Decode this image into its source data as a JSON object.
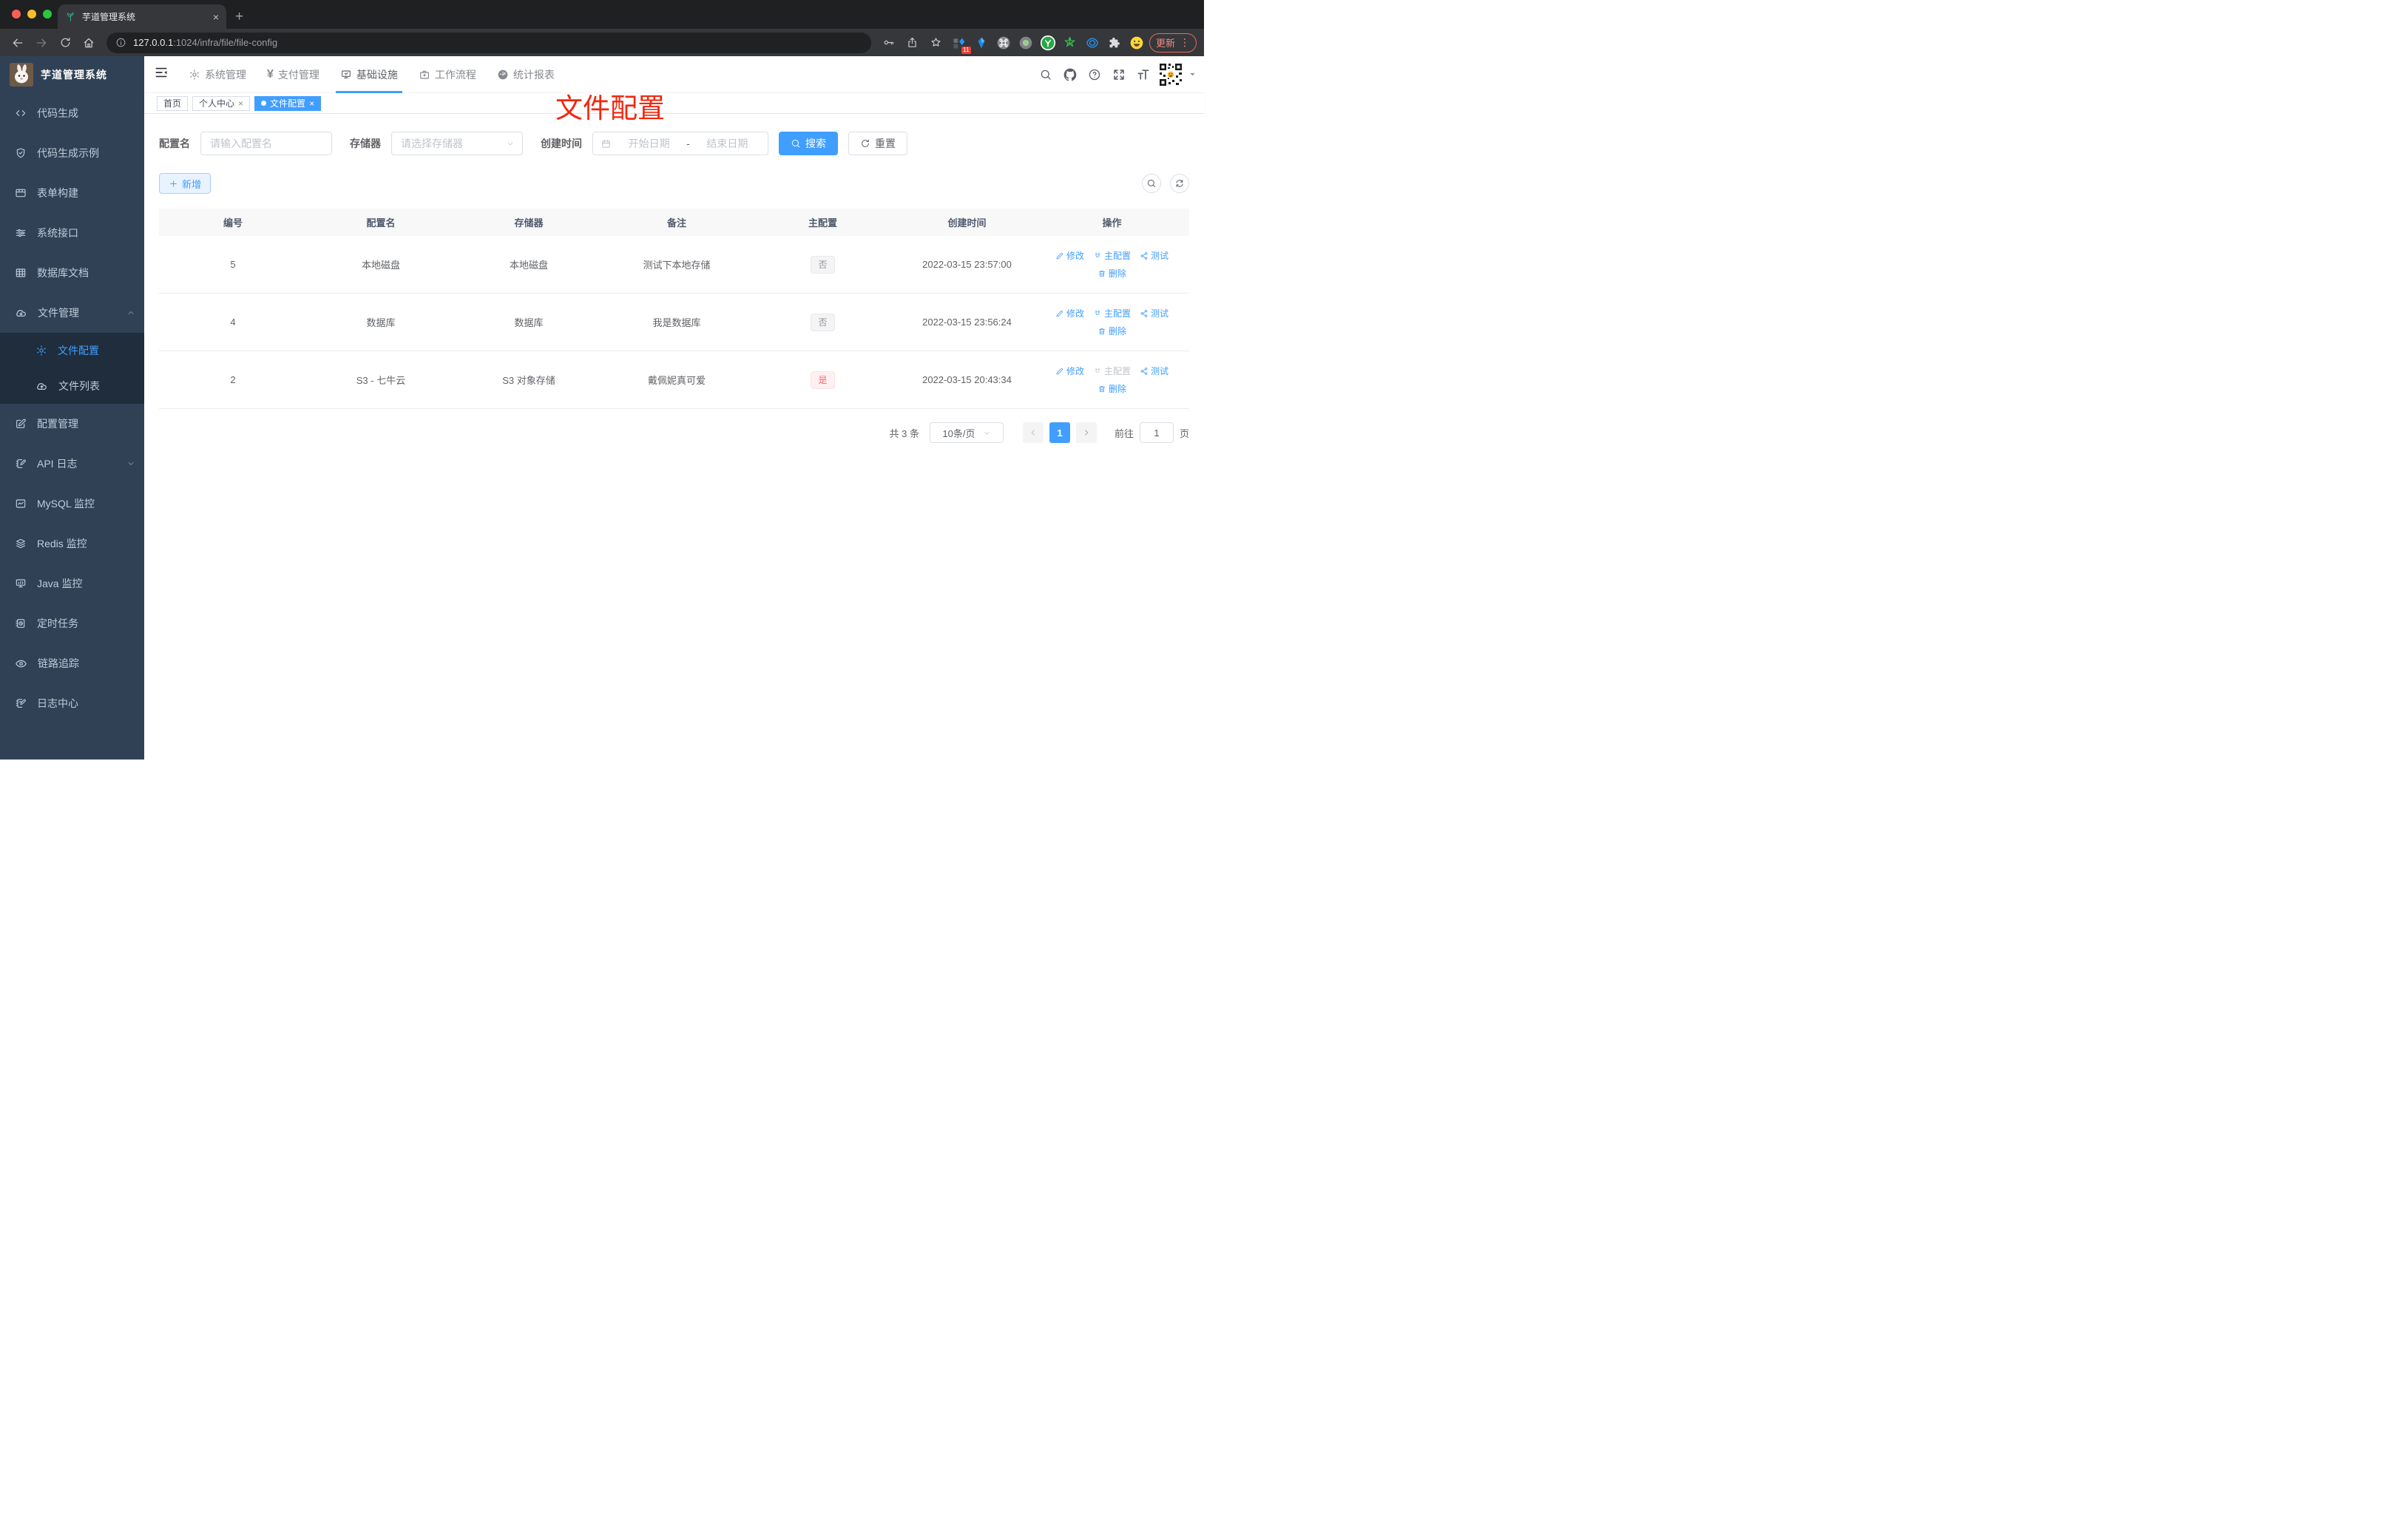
{
  "browser": {
    "tab_title": "芋道管理系统",
    "close_glyph": "×",
    "new_tab_glyph": "+",
    "url_host": "127.0.0.1",
    "url_rest": ":1024/infra/file/file-config",
    "ext_badge": "11",
    "update_label": "更新",
    "menu_dots": "⋮"
  },
  "sidebar": {
    "title": "芋道管理系统",
    "items": [
      {
        "label": "代码生成",
        "icon": "code-icon"
      },
      {
        "label": "代码生成示例",
        "icon": "shield-check-icon"
      },
      {
        "label": "表单构建",
        "icon": "form-icon"
      },
      {
        "label": "系统接口",
        "icon": "sliders-icon"
      },
      {
        "label": "数据库文档",
        "icon": "grid-icon"
      },
      {
        "label": "文件管理",
        "icon": "cloud-download-icon"
      },
      {
        "label": "文件配置",
        "icon": "gear-icon"
      },
      {
        "label": "文件列表",
        "icon": "cloud-upload-icon"
      },
      {
        "label": "配置管理",
        "icon": "edit-square-icon"
      },
      {
        "label": "API 日志",
        "icon": "doc-edit-icon"
      },
      {
        "label": "MySQL 监控",
        "icon": "chart-icon"
      },
      {
        "label": "Redis 监控",
        "icon": "layers-icon"
      },
      {
        "label": "Java 监控",
        "icon": "monitor-icon"
      },
      {
        "label": "定时任务",
        "icon": "schedule-icon"
      },
      {
        "label": "链路追踪",
        "icon": "eye-icon"
      },
      {
        "label": "日志中心",
        "icon": "log-icon"
      }
    ]
  },
  "topnav": {
    "items": [
      {
        "label": "系统管理",
        "icon": "gear-icon"
      },
      {
        "label": "支付管理",
        "icon": "yen-icon",
        "glyph": "¥"
      },
      {
        "label": "基础设施",
        "icon": "monitor-check-icon"
      },
      {
        "label": "工作流程",
        "icon": "briefcase-icon"
      },
      {
        "label": "统计报表",
        "icon": "gauge-icon"
      }
    ]
  },
  "tabs": {
    "close_glyph": "×",
    "items": [
      {
        "label": "首页"
      },
      {
        "label": "个人中心"
      },
      {
        "label": "文件配置"
      }
    ]
  },
  "annotation": {
    "text": "文件配置"
  },
  "filters": {
    "name_label": "配置名",
    "name_placeholder": "请输入配置名",
    "storage_label": "存储器",
    "storage_placeholder": "请选择存储器",
    "date_label": "创建时间",
    "date_start": "开始日期",
    "date_sep": "-",
    "date_end": "结束日期",
    "search_label": "搜索",
    "reset_label": "重置"
  },
  "toolbar": {
    "add_label": "新增"
  },
  "table": {
    "headers": [
      "编号",
      "配置名",
      "存储器",
      "备注",
      "主配置",
      "创建时间",
      "操作"
    ],
    "action_labels": {
      "edit": "修改",
      "master": "主配置",
      "test": "测试",
      "del": "删除"
    },
    "rows": [
      {
        "id": "5",
        "name": "本地磁盘",
        "storage": "本地磁盘",
        "remark": "测试下本地存储",
        "master": "否",
        "created": "2022-03-15 23:57:00"
      },
      {
        "id": "4",
        "name": "数据库",
        "storage": "数据库",
        "remark": "我是数据库",
        "master": "否",
        "created": "2022-03-15 23:56:24"
      },
      {
        "id": "2",
        "name": "S3 - 七牛云",
        "storage": "S3 对象存储",
        "remark": "戴佩妮真可爱",
        "master": "是",
        "created": "2022-03-15 20:43:34"
      }
    ]
  },
  "pagination": {
    "total": "共 3 条",
    "page_size": "10条/页",
    "page": "1",
    "goto_label": "前往",
    "goto_value": "1",
    "goto_suffix": "页",
    "colors": {
      "accent": "#409eff",
      "danger": "#f56c6c",
      "annotation_red": "#f2270f"
    }
  }
}
